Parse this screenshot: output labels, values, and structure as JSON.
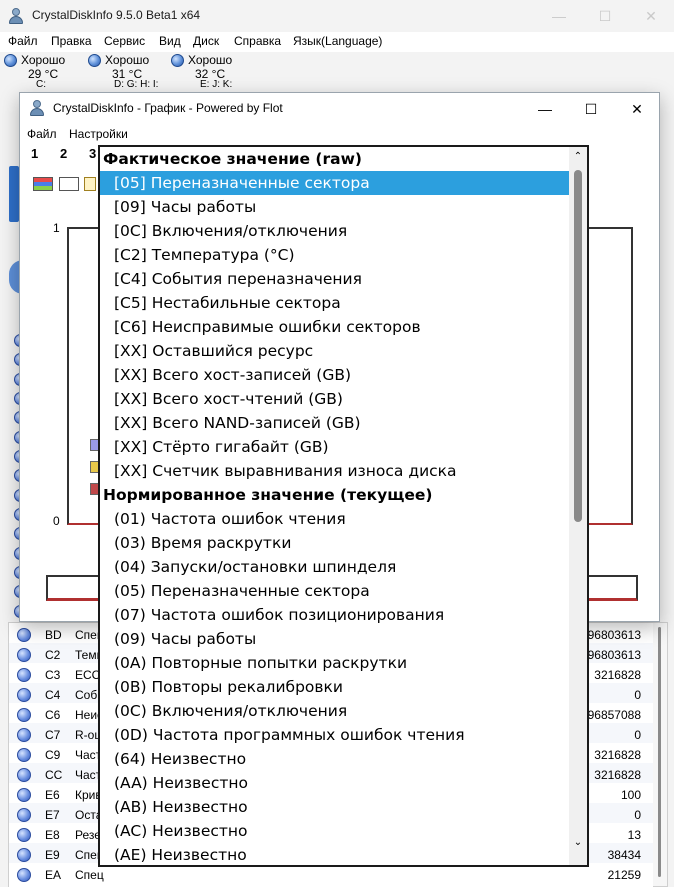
{
  "main_window": {
    "title": "CrystalDiskInfo 9.5.0 Beta1 x64",
    "buttons": {
      "minimize": "—",
      "maximize": "☐",
      "close": "✕"
    },
    "menu": [
      "Файл",
      "Правка",
      "Сервис",
      "Вид",
      "Диск",
      "Справка",
      "Язык(Language)"
    ],
    "drives": [
      {
        "status": "Хорошо",
        "temperature": "29 °C",
        "letters": "C:"
      },
      {
        "status": "Хорошо",
        "temperature": "31 °C",
        "letters": "D: G: H: I:"
      },
      {
        "status": "Хорошо",
        "temperature": "32 °C",
        "letters": "E: J: K:"
      }
    ]
  },
  "smart_rows": [
    {
      "id": "BD",
      "name": "Спец",
      "raw": "96803613"
    },
    {
      "id": "C2",
      "name": "Темп",
      "raw": "96803613"
    },
    {
      "id": "C3",
      "name": "ECC-",
      "raw": "3216828"
    },
    {
      "id": "C4",
      "name": "Собы",
      "raw": "0"
    },
    {
      "id": "C6",
      "name": "Неис",
      "raw": "96857088"
    },
    {
      "id": "C7",
      "name": "R-ош",
      "raw": "0"
    },
    {
      "id": "C9",
      "name": "Части",
      "raw": "3216828"
    },
    {
      "id": "CC",
      "name": "Части",
      "raw": "3216828"
    },
    {
      "id": "E6",
      "name": "Крив",
      "raw": "100"
    },
    {
      "id": "E7",
      "name": "Оста",
      "raw": "0"
    },
    {
      "id": "E8",
      "name": "Резе",
      "raw": "13"
    },
    {
      "id": "E9",
      "name": "Спец",
      "raw": "38434"
    },
    {
      "id": "EA",
      "name": "Спец",
      "raw": "21259"
    }
  ],
  "graph_window": {
    "title": "CrystalDiskInfo - График - Powered by Flot",
    "buttons": {
      "minimize": "—",
      "maximize": "☐",
      "close": "✕"
    },
    "menu": [
      "Файл",
      "Настройки"
    ],
    "tabs": [
      "1",
      "2",
      "3"
    ],
    "y_axis": {
      "top": "1",
      "bottom": "0"
    },
    "legend_colors": [
      "#9a9ae8",
      "#e8c84a",
      "#c0484a"
    ]
  },
  "dropdown": {
    "selected_index": 0,
    "raw_header": "Фактическое значение (raw)",
    "raw_items": [
      "[05] Переназначенные сектора",
      "[09] Часы работы",
      "[0C] Включения/отключения",
      "[C2] Температура (°C)",
      "[C4] События переназначения",
      "[C5] Нестабильные сектора",
      "[C6] Неисправимые ошибки секторов",
      "[XX] Оставшийся ресурс",
      "[XX] Всего хост-записей (GB)",
      "[XX] Всего хост-чтений (GB)",
      "[XX] Всего NAND-записей (GB)",
      "[XX] Стёрто гигабайт (GB)",
      "[XX] Счетчик выравнивания износа диска"
    ],
    "normalized_header": "Нормированное значение (текущее)",
    "normalized_items": [
      "(01) Частота ошибок чтения",
      "(03) Время раскрутки",
      "(04) Запуски/остановки шпинделя",
      "(05) Переназначенные сектора",
      "(07) Частота ошибок позиционирования",
      "(09) Часы работы",
      "(0A) Повторные попытки раскрутки",
      "(0B) Повторы рекалибровки",
      "(0C) Включения/отключения",
      "(0D) Частота программных ошибок чтения",
      "(64) Неизвестно",
      "(AA) Неизвестно",
      "(AB) Неизвестно",
      "(AC) Неизвестно",
      "(AE) Неизвестно"
    ],
    "scroll_up": "⌃",
    "scroll_down": "⌄"
  }
}
